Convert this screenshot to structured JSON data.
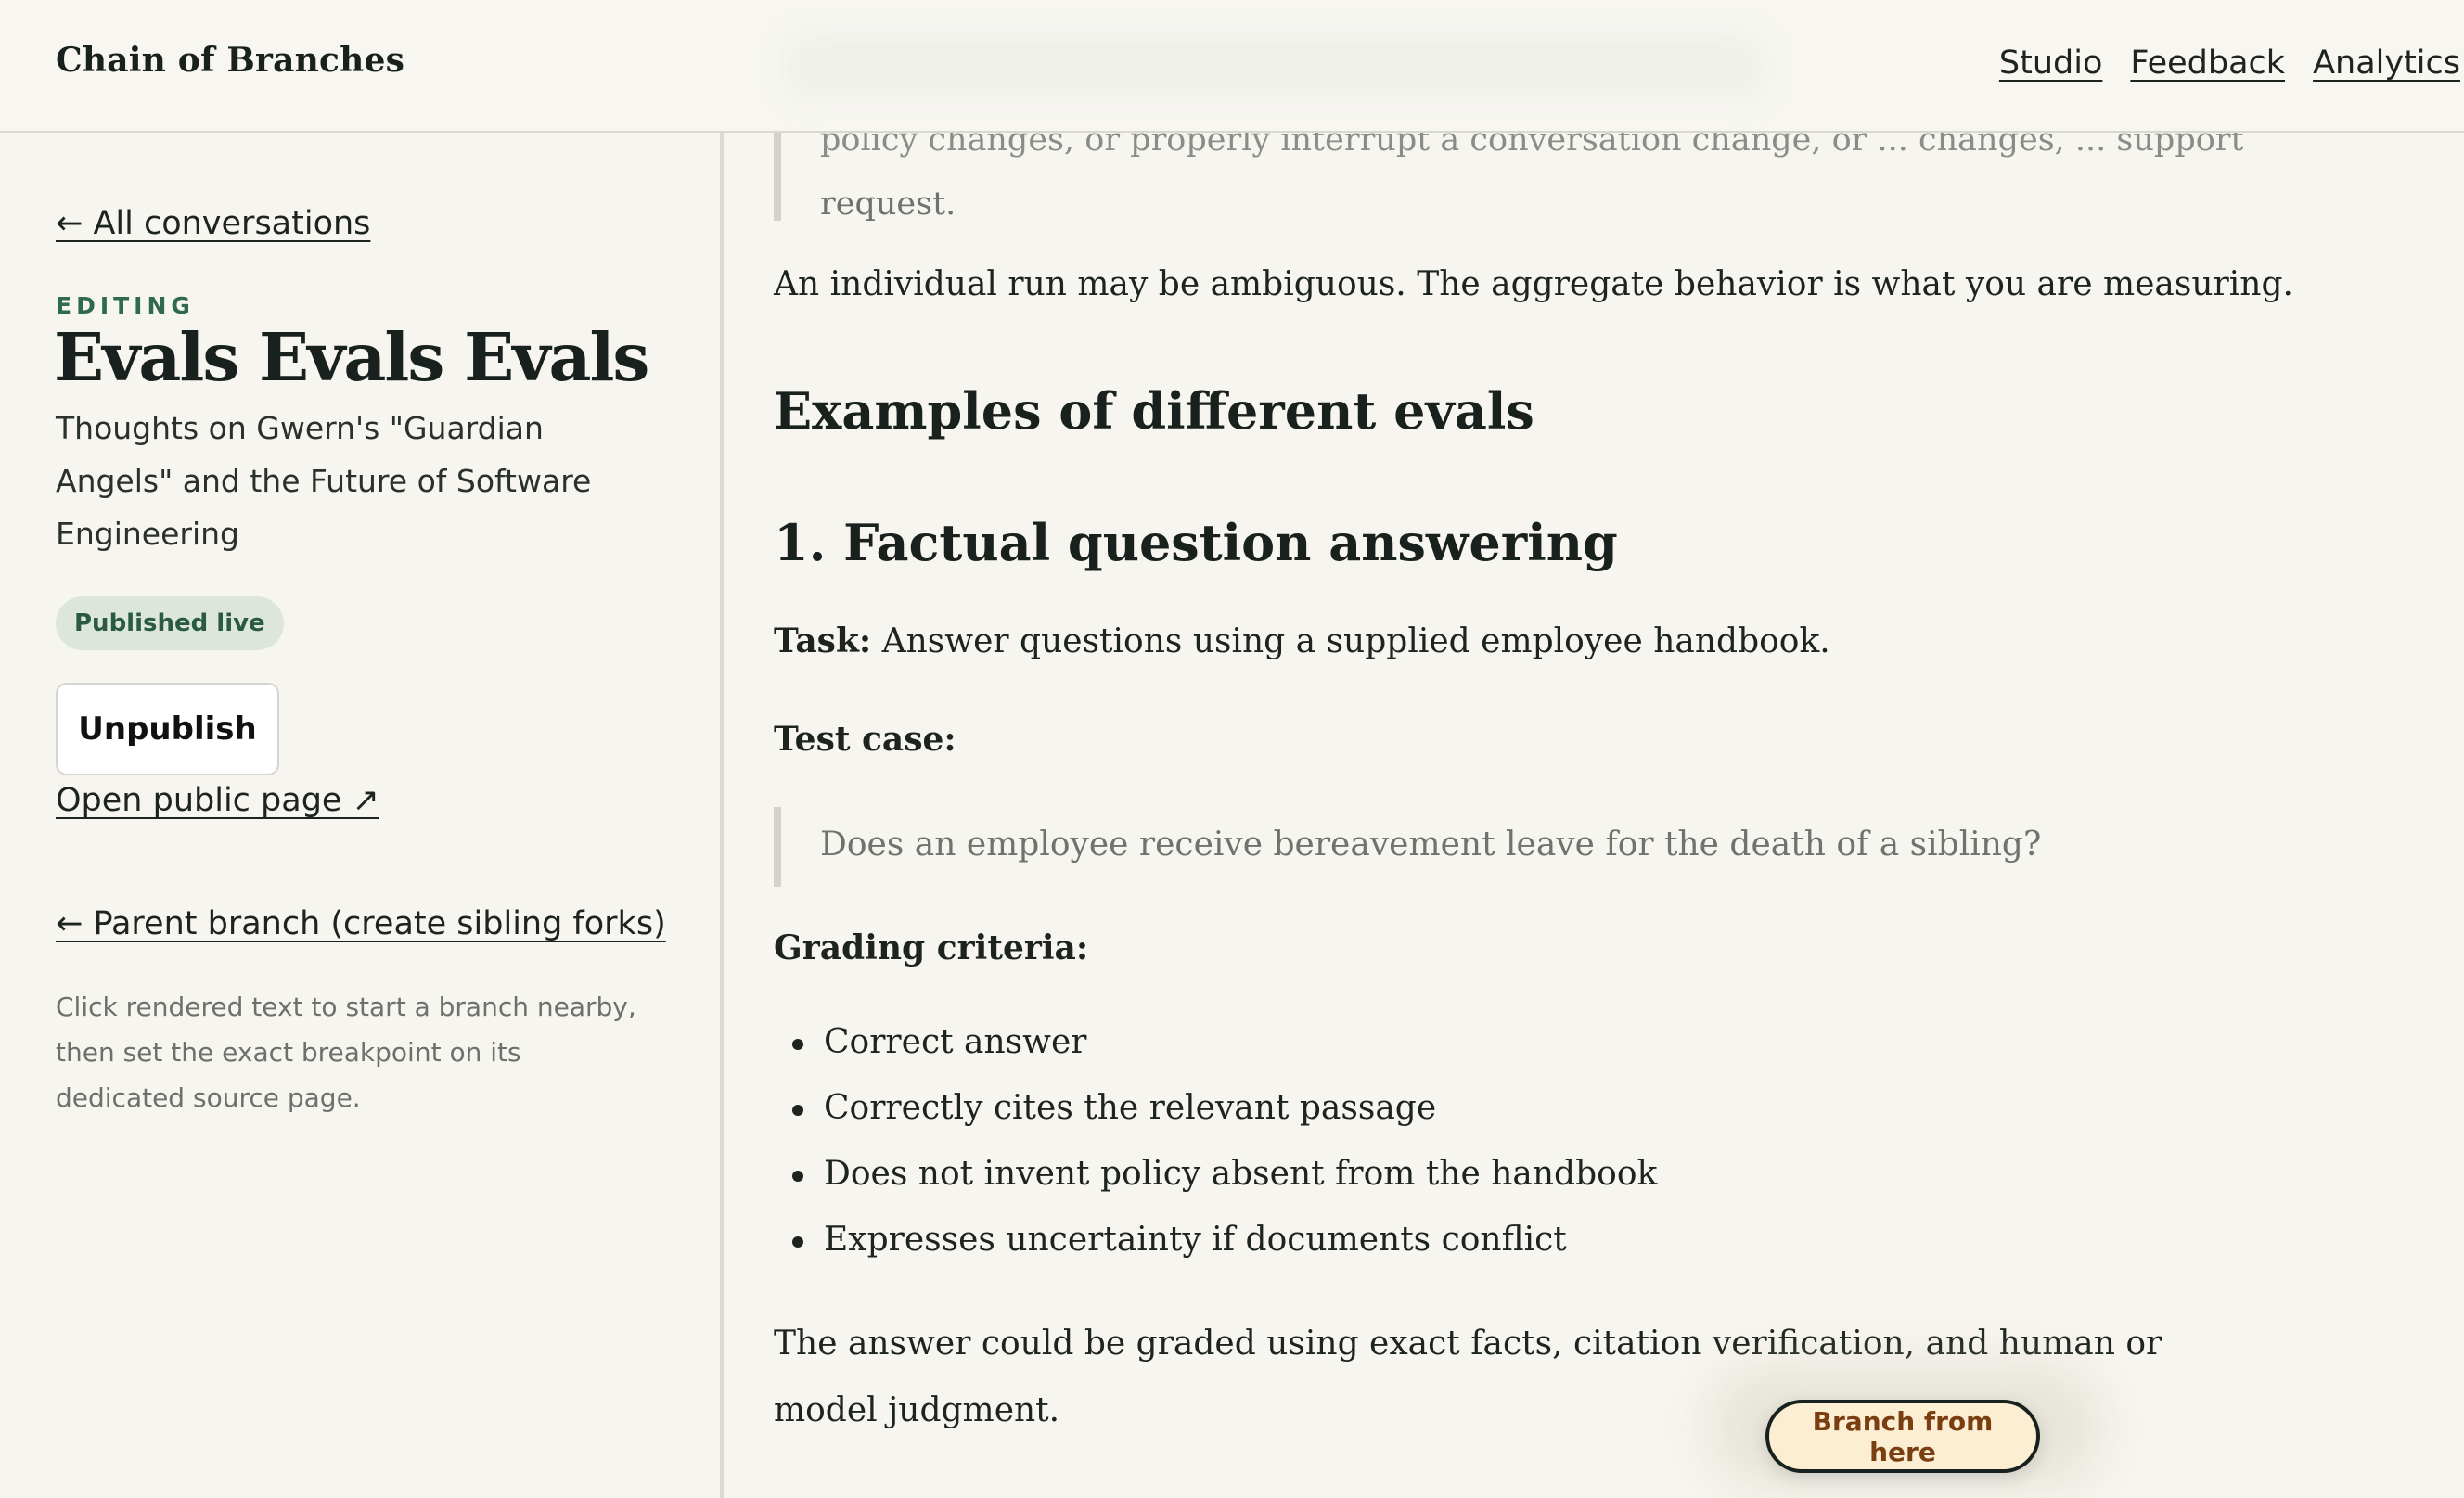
{
  "header": {
    "brand": "Chain of Branches",
    "nav": [
      "Studio",
      "Feedback",
      "Analytics"
    ]
  },
  "sidebar": {
    "back_link": "← All conversations",
    "editing_label": "EDITING",
    "title": "Evals Evals Evals",
    "subtitle": "Thoughts on Gwern's \"Guardian Angels\" and the Future of Software Engineering",
    "status_badge": "Published live",
    "unpublish_label": "Unpublish",
    "public_link": "Open public page ↗",
    "parent_link": "← Parent branch (create sibling forks)",
    "help_text": "Click rendered text to start a branch nearby, then set the exact breakpoint on its dedicated source page."
  },
  "main": {
    "quote_clipped": "policy changes, or properly interrupt a conversation change, or ... changes, ... support",
    "quote_end": "request.",
    "para_1": "An individual run may be ambiguous. The aggregate behavior is what you are measuring.",
    "h2": "Examples of different evals",
    "h3": "1. Factual question answering",
    "task_label": "Task:",
    "task_text": " Answer questions using a supplied employee handbook.",
    "test_case_heading": "Test case:",
    "test_case_quote": "Does an employee receive bereavement leave for the death of a sibling?",
    "grading_heading": "Grading criteria:",
    "criteria": [
      "Correct answer",
      "Correctly cites the relevant passage",
      "Does not invent policy absent from the handbook",
      "Expresses uncertainty if documents conflict"
    ],
    "para_2": "The answer could be graded using exact facts, citation verification, and human or model judgment.",
    "branch_button": "Branch from here"
  }
}
